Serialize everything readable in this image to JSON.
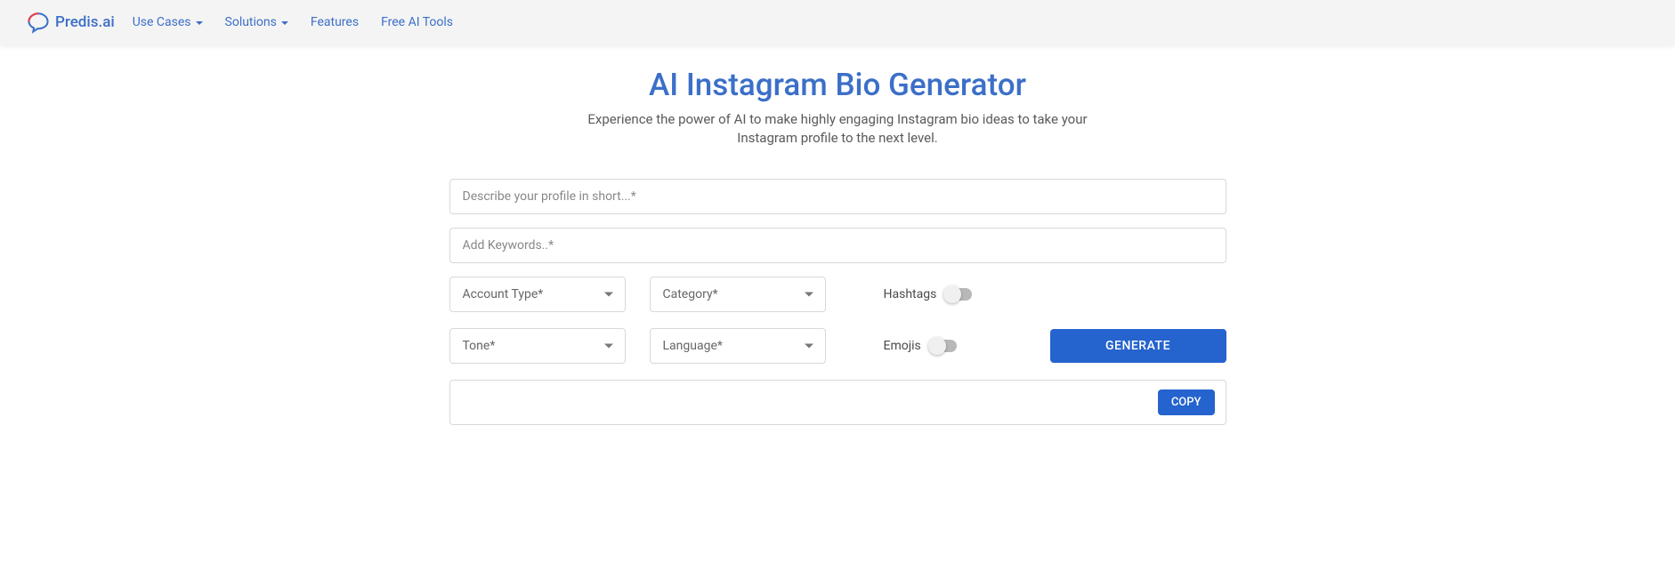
{
  "header": {
    "logo_text": "Predis.ai",
    "nav": [
      {
        "label": "Use Cases",
        "has_dropdown": true
      },
      {
        "label": "Solutions",
        "has_dropdown": true
      },
      {
        "label": "Features",
        "has_dropdown": false
      },
      {
        "label": "Free AI Tools",
        "has_dropdown": false
      }
    ]
  },
  "main": {
    "title": "AI Instagram Bio Generator",
    "subtitle": "Experience the power of AI to make highly engaging Instagram bio ideas to take your Instagram profile to the next level."
  },
  "form": {
    "describe_placeholder": "Describe your profile in short...*",
    "keywords_placeholder": "Add Keywords..*",
    "account_type_label": "Account Type*",
    "category_label": "Category*",
    "tone_label": "Tone*",
    "language_label": "Language*",
    "hashtags_label": "Hashtags",
    "emojis_label": "Emojis",
    "generate_label": "GENERATE",
    "copy_label": "COPY"
  }
}
